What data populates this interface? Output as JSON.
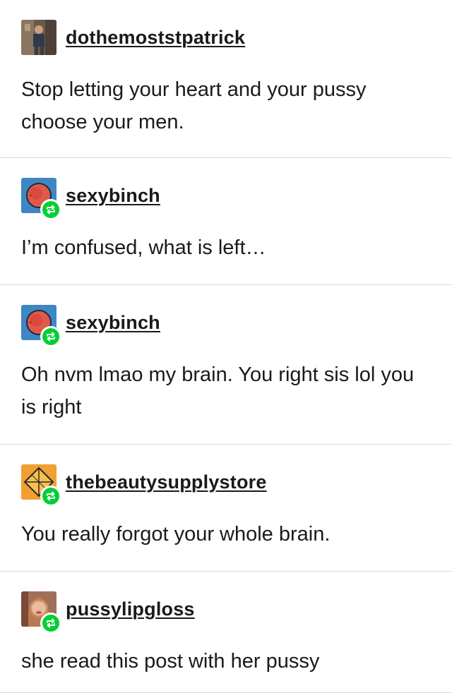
{
  "posts": [
    {
      "username": "dothemoststpatrick",
      "text": "Stop letting your heart and your pussy choose your men.",
      "reblog": false,
      "avatar": "photo-avatar"
    },
    {
      "username": "sexybinch",
      "text": "I’m confused, what is left…",
      "reblog": true,
      "avatar": "red-circle-avatar"
    },
    {
      "username": "sexybinch",
      "text": "Oh nvm lmao my brain. You right sis lol you is right",
      "reblog": true,
      "avatar": "red-circle-avatar"
    },
    {
      "username": "thebeautysupplystore",
      "text": "You really forgot your whole brain.",
      "reblog": true,
      "avatar": "diamond-avatar"
    },
    {
      "username": "pussylipgloss",
      "text": "she read this post with her pussy",
      "reblog": true,
      "avatar": "photo-avatar"
    }
  ],
  "colors": {
    "reblog_badge": "#00cf35",
    "divider": "#d9d9d9",
    "text": "#1a1a1a"
  },
  "icons": {
    "reblog": "reblog-icon"
  }
}
